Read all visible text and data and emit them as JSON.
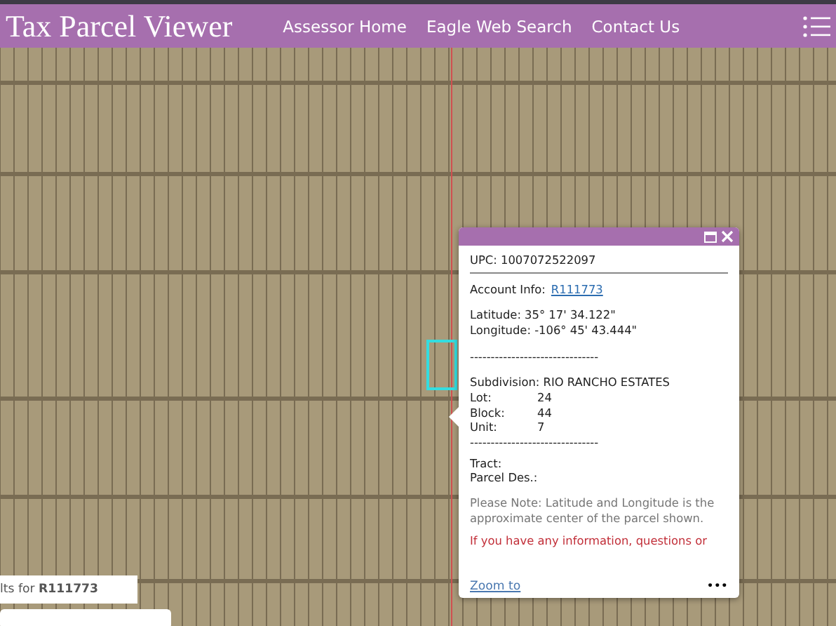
{
  "header": {
    "title": "Tax Parcel Viewer",
    "nav": [
      "Assessor Home",
      "Eagle Web Search",
      "Contact Us"
    ]
  },
  "popup": {
    "upc": "UPC: 1007072522097",
    "account_label": "Account Info:",
    "account_link": "R111773",
    "latitude": "Latitude: 35° 17' 34.122\"",
    "longitude": "Longitude: -106° 45' 43.444\"",
    "separator": "-------------------------------",
    "subdivision": "Subdivision: RIO RANCHO ESTATES",
    "fields": [
      {
        "label": "Lot:",
        "value": "24"
      },
      {
        "label": "Block:",
        "value": "44"
      },
      {
        "label": "Unit:",
        "value": "7"
      }
    ],
    "separator2": "-------------------------------",
    "tract": "Tract:",
    "parcel_des": "Parcel Des.:",
    "note": "Please Note: Latitude and Longitude is the approximate center of the parcel shown.",
    "warning": "If you have any information, questions or",
    "zoom_link": "Zoom to",
    "more": "•••"
  },
  "results": {
    "text": "lts for **R111773**"
  }
}
